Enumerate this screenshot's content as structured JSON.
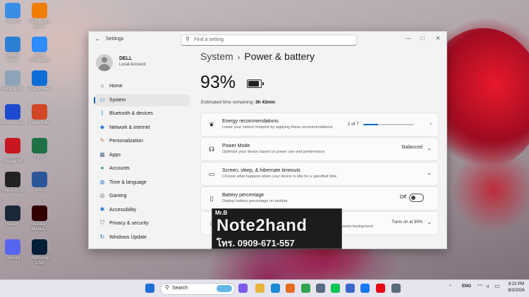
{
  "desktop": {
    "icons": [
      {
        "label": "This PC",
        "icon": "computer-icon",
        "color": "#3a8ee6"
      },
      {
        "label": "VLC media player",
        "icon": "vlc-icon",
        "color": "#f07d00"
      },
      {
        "label": "Control Panel",
        "icon": "control-panel-icon",
        "color": "#2d7fd3"
      },
      {
        "label": "Zoom Workplace",
        "icon": "zoom-icon",
        "color": "#2d8cff"
      },
      {
        "label": "Recycle Bin",
        "icon": "recycle-bin-icon",
        "color": "#8fa3b8"
      },
      {
        "label": "TeamViewer",
        "icon": "teamviewer-icon",
        "color": "#0e6ed8"
      },
      {
        "label": "Malwareby...",
        "icon": "malwarebytes-icon",
        "color": "#1f4bd1"
      },
      {
        "label": "PowerPoint",
        "icon": "powerpoint-icon",
        "color": "#d24726"
      },
      {
        "label": "Adobe Reader XI",
        "icon": "adobe-reader-icon",
        "color": "#c8171e"
      },
      {
        "label": "Excel",
        "icon": "excel-icon",
        "color": "#1e7145"
      },
      {
        "label": "foobar2000",
        "icon": "foobar-icon",
        "color": "#222222"
      },
      {
        "label": "Word",
        "icon": "word-icon",
        "color": "#2b579a"
      },
      {
        "label": "Steam",
        "icon": "steam-icon",
        "color": "#1b2838"
      },
      {
        "label": "Adobe Illustra...",
        "icon": "illustrator-icon",
        "color": "#330000"
      },
      {
        "label": "Discord",
        "icon": "discord-icon",
        "color": "#5865f2"
      },
      {
        "label": "Photoshop CS6",
        "icon": "photoshop-icon",
        "color": "#001e36"
      }
    ]
  },
  "window": {
    "app_title": "Settings",
    "search_placeholder": "Find a setting",
    "user": {
      "name": "DELL",
      "account": "Local Account"
    },
    "nav": [
      {
        "label": "Home",
        "icon": "home-icon",
        "glyph": "⌂",
        "color": "#555555"
      },
      {
        "label": "System",
        "icon": "system-icon",
        "glyph": "▭",
        "color": "#0078d4"
      },
      {
        "label": "Bluetooth & devices",
        "icon": "bluetooth-icon",
        "glyph": "ᛒ",
        "color": "#0078d4"
      },
      {
        "label": "Network & internet",
        "icon": "wifi-icon",
        "glyph": "◆",
        "color": "#2a7de1"
      },
      {
        "label": "Personalization",
        "icon": "brush-icon",
        "glyph": "✎",
        "color": "#c76d28"
      },
      {
        "label": "Apps",
        "icon": "apps-icon",
        "glyph": "▦",
        "color": "#5a6f8a"
      },
      {
        "label": "Accounts",
        "icon": "accounts-icon",
        "glyph": "●",
        "color": "#1c9e6b"
      },
      {
        "label": "Time & language",
        "icon": "globe-icon",
        "glyph": "◍",
        "color": "#2a7de1"
      },
      {
        "label": "Gaming",
        "icon": "gaming-icon",
        "glyph": "◎",
        "color": "#666666"
      },
      {
        "label": "Accessibility",
        "icon": "accessibility-icon",
        "glyph": "✱",
        "color": "#1a6fd1"
      },
      {
        "label": "Privacy & security",
        "icon": "shield-icon",
        "glyph": "⛉",
        "color": "#666666"
      },
      {
        "label": "Windows Update",
        "icon": "windows-update-icon",
        "glyph": "↻",
        "color": "#1a6fd1"
      }
    ],
    "active_nav_index": 1,
    "breadcrumb": {
      "parent": "System",
      "current": "Power & battery"
    },
    "battery": {
      "percent_label": "93%",
      "level": 0.93,
      "estimate_label": "Estimated time remaining:",
      "estimate_value": "3h 43min"
    },
    "cards": [
      {
        "title": "Energy recommendations",
        "subtitle": "Lower your carbon footprint by applying these recommendations",
        "icon": "leaf-icon",
        "glyph": "❦",
        "progress_text": "2 of 7",
        "progress": 0.29
      },
      {
        "title": "Power Mode",
        "subtitle": "Optimize your device based on power use and performance",
        "icon": "power-mode-icon",
        "glyph": "☊",
        "value": "Balanced"
      },
      {
        "title": "Screen, sleep, & hibernate timeouts",
        "subtitle": "Choose what happens when your device is idle for a specified time",
        "icon": "screen-icon",
        "glyph": "▭"
      },
      {
        "title": "Battery percentage",
        "subtitle": "Display battery percentage on taskbar",
        "icon": "battery-icon",
        "glyph": "▯",
        "toggle_label": "Off",
        "toggle_on": false
      },
      {
        "title": "",
        "subtitle": "some background",
        "icon": "battery-saver-icon",
        "glyph": "⌂",
        "value": "Turns on at 30%"
      }
    ]
  },
  "watermark": {
    "line1": "Mr.B",
    "line2": "Note2hand",
    "line3": "โทร. 0909-671-557"
  },
  "taskbar": {
    "search_label": "Search",
    "apps": [
      {
        "icon": "windows-start-icon",
        "color": "#1f6fd6"
      },
      {
        "icon": "copilot-icon",
        "color": "#7a5de8"
      },
      {
        "icon": "file-explorer-icon",
        "color": "#e8b33a"
      },
      {
        "icon": "edge-icon",
        "color": "#1a8bd4"
      },
      {
        "icon": "firefox-icon",
        "color": "#e66b1f"
      },
      {
        "icon": "chrome-icon",
        "color": "#2ea44f"
      },
      {
        "icon": "camera-icon",
        "color": "#5a6b80"
      },
      {
        "icon": "line-icon",
        "color": "#06c755"
      },
      {
        "icon": "microsoft-store-icon",
        "color": "#3a67c9"
      },
      {
        "icon": "facebook-icon",
        "color": "#1877f2"
      },
      {
        "icon": "netflix-icon",
        "color": "#e50914"
      },
      {
        "icon": "settings-icon",
        "color": "#5c6a7a"
      }
    ],
    "lang": "ENG",
    "time": "8:22 PM",
    "date": "8/3/2026"
  }
}
